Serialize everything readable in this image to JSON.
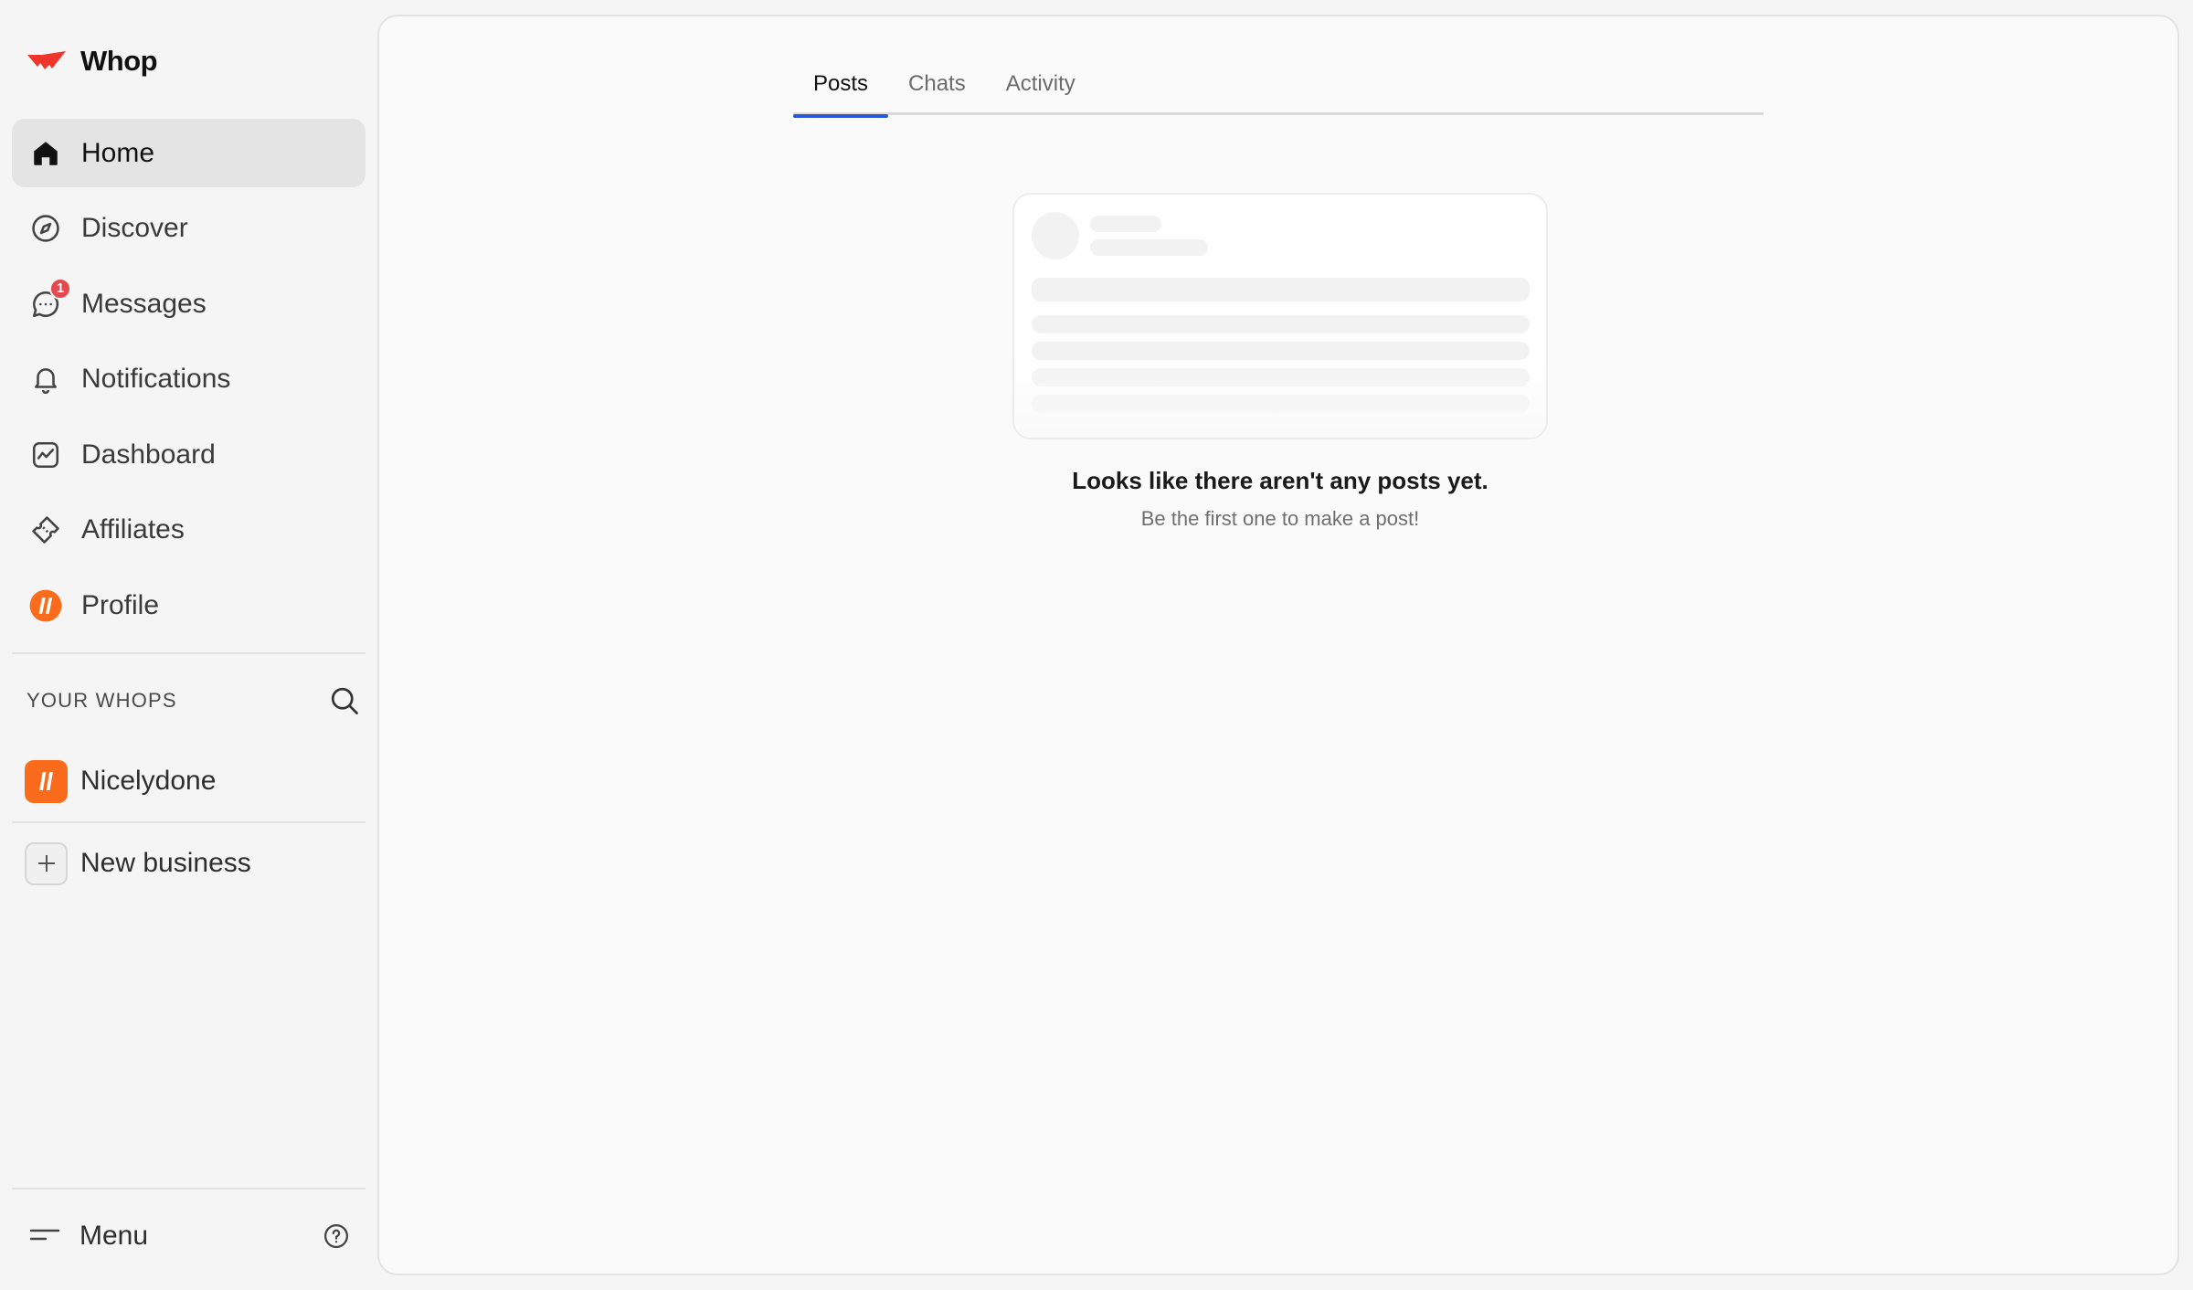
{
  "brand": {
    "name": "Whop"
  },
  "sidebar": {
    "items": [
      {
        "label": "Home",
        "icon": "home-icon",
        "active": true
      },
      {
        "label": "Discover",
        "icon": "compass-icon"
      },
      {
        "label": "Messages",
        "icon": "chat-bubble-icon",
        "badge": "1"
      },
      {
        "label": "Notifications",
        "icon": "bell-icon"
      },
      {
        "label": "Dashboard",
        "icon": "chart-icon"
      },
      {
        "label": "Affiliates",
        "icon": "ticket-icon"
      },
      {
        "label": "Profile",
        "icon": "profile-avatar-icon"
      }
    ],
    "section_title": "YOUR WHOPS",
    "whops": [
      {
        "label": "Nicelydone"
      }
    ],
    "new_business_label": "New business",
    "menu_label": "Menu"
  },
  "main": {
    "tabs": [
      {
        "label": "Posts",
        "active": true
      },
      {
        "label": "Chats"
      },
      {
        "label": "Activity"
      }
    ],
    "empty_title": "Looks like there aren't any posts yet.",
    "empty_subtitle": "Be the first one to make a post!"
  },
  "colors": {
    "brand_red": "#f0362b",
    "accent_orange": "#fa6b1b",
    "tab_underline": "#2b57d6",
    "badge": "#e5484d"
  }
}
